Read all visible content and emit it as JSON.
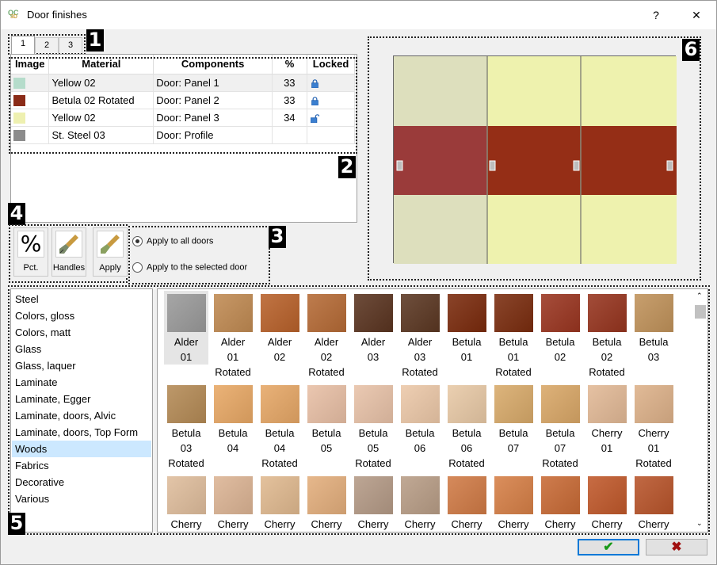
{
  "window": {
    "title": "Door finishes",
    "help_label": "?",
    "close_label": "✕"
  },
  "callouts": [
    "1",
    "2",
    "3",
    "4",
    "5",
    "6"
  ],
  "tabs": [
    "1",
    "2",
    "3"
  ],
  "table": {
    "headers": [
      "Image",
      "Material",
      "Components",
      "%",
      "Locked"
    ],
    "rows": [
      {
        "color": "#b5dccb",
        "material": "Yellow 02",
        "component": "Door: Panel 1",
        "pct": "33",
        "locked": true
      },
      {
        "color": "#8a2b17",
        "material": "Betula 02 Rotated",
        "component": "Door: Panel 2",
        "pct": "33",
        "locked": true
      },
      {
        "color": "#eef0b0",
        "material": "Yellow 02",
        "component": "Door: Panel 3",
        "pct": "34",
        "locked": false
      },
      {
        "color": "#8c8c8c",
        "material": "St. Steel 03",
        "component": "Door: Profile",
        "pct": "",
        "locked": null
      }
    ]
  },
  "tools": [
    {
      "label": "Pct.",
      "icon": "percent-icon"
    },
    {
      "label": "Handles",
      "icon": "brush-icon"
    },
    {
      "label": "Apply",
      "icon": "brush-icon"
    }
  ],
  "radios": [
    {
      "label": "Apply to all doors",
      "checked": true
    },
    {
      "label": "Apply to the selected door",
      "checked": false
    }
  ],
  "categories": [
    "Steel",
    "Colors, gloss",
    "Colors, matt",
    "Glass",
    "Glass, laquer",
    "Laminate",
    "Laminate, Egger",
    "Laminate, doors, Alvic",
    "Laminate, doors, Top Form",
    "Woods",
    "Fabrics",
    "Decorative",
    "Various"
  ],
  "selected_category": "Woods",
  "materials": [
    {
      "name": "Alder\n01",
      "color": "#9a9a9a"
    },
    {
      "name": "Alder\n01\nRotated",
      "color": "#c08a52"
    },
    {
      "name": "Alder\n02",
      "color": "#b8612a"
    },
    {
      "name": "Alder\n02\nRotated",
      "color": "#b56a35"
    },
    {
      "name": "Alder\n03",
      "color": "#5a3420"
    },
    {
      "name": "Alder\n03\nRotated",
      "color": "#5b3722"
    },
    {
      "name": "Betula\n01",
      "color": "#7a2a0c"
    },
    {
      "name": "Betula\n01\nRotated",
      "color": "#7a2c0e"
    },
    {
      "name": "Betula\n02",
      "color": "#9a3520"
    },
    {
      "name": "Betula\n02\nRotated",
      "color": "#96341e"
    },
    {
      "name": "Betula\n03",
      "color": "#c0925a"
    },
    {
      "name": "Betula\n03\nRotated",
      "color": "#b48a55"
    },
    {
      "name": "Betula\n04",
      "color": "#e8a865"
    },
    {
      "name": "Betula\n04\nRotated",
      "color": "#e6a766"
    },
    {
      "name": "Betula\n05",
      "color": "#e8bfa5"
    },
    {
      "name": "Betula\n05\nRotated",
      "color": "#e8c2a8"
    },
    {
      "name": "Betula\n06",
      "color": "#ecc8a8"
    },
    {
      "name": "Betula\n06\nRotated",
      "color": "#e8c9a6"
    },
    {
      "name": "Betula\n07",
      "color": "#d8aa6a"
    },
    {
      "name": "Betula\n07\nRotated",
      "color": "#d9a767"
    },
    {
      "name": "Cherry\n01",
      "color": "#e2b996"
    },
    {
      "name": "Cherry\n01\nRotated",
      "color": "#ddb189"
    },
    {
      "name": "Cherry",
      "color": "#dfbd9c"
    },
    {
      "name": "Cherry",
      "color": "#dcb494"
    },
    {
      "name": "Cherry",
      "color": "#e0b98f"
    },
    {
      "name": "Cherry",
      "color": "#e3ae7c"
    },
    {
      "name": "Cherry",
      "color": "#b49a86"
    },
    {
      "name": "Cherry",
      "color": "#b89d86"
    },
    {
      "name": "Cherry",
      "color": "#d07a45"
    },
    {
      "name": "Cherry",
      "color": "#d67f46"
    },
    {
      "name": "Cherry",
      "color": "#c86a35"
    },
    {
      "name": "Cherry",
      "color": "#c0582a"
    },
    {
      "name": "Cherry",
      "color": "#b8542a"
    }
  ],
  "preview": {
    "left_top": "#dddfbd",
    "left_band": "#9a3b3a",
    "band": "#952e16",
    "yellow": "#eef2ae",
    "divider": "#8a8a7a"
  },
  "buttons": {
    "ok_label": "✔",
    "cancel_label": "✖"
  }
}
